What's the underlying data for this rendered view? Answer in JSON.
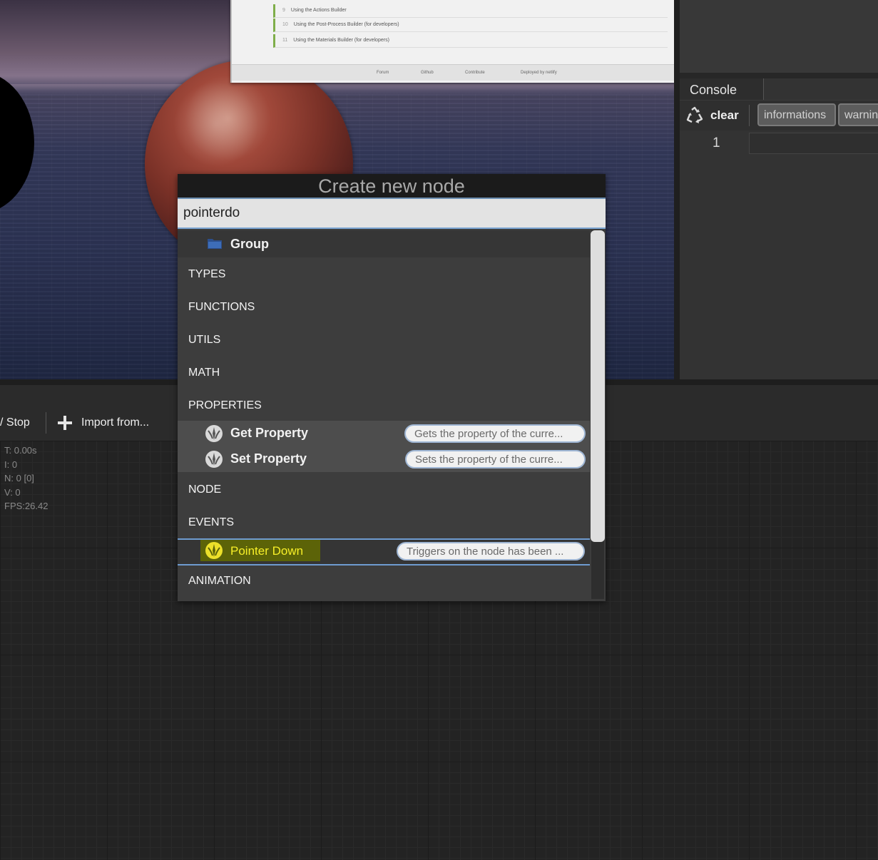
{
  "dialog": {
    "title": "Create new node",
    "search_value": "pointerdo",
    "group_label": "Group",
    "categories": {
      "types": "TYPES",
      "functions": "FUNCTIONS",
      "utils": "UTILS",
      "math": "MATH",
      "properties": "PROPERTIES",
      "node": "NODE",
      "events": "EVENTS",
      "animation": "ANIMATION"
    },
    "properties_items": [
      {
        "label": "Get Property",
        "description": "Gets the property of the curre..."
      },
      {
        "label": "Set Property",
        "description": "Sets the property of the curre..."
      }
    ],
    "events_items": [
      {
        "label": "Pointer Down",
        "description": "Triggers on the node has been ..."
      }
    ]
  },
  "console": {
    "tab_label": "Console",
    "clear_label": "clear",
    "filters": [
      "informations",
      "warnin"
    ],
    "line_number": "1"
  },
  "graph_toolbar": {
    "play_stop_label": "/ Stop",
    "import_label": "Import from..."
  },
  "stats": {
    "time": "T: 0.00s",
    "iterations": "I: 0",
    "nodes": "N: 0 [0]",
    "vertices": "V: 0",
    "fps": "FPS:26.42"
  },
  "doc_panel": {
    "lines": [
      {
        "num": "9",
        "text": "Using the Actions Builder"
      },
      {
        "num": "10",
        "text": "Using the Post-Process Builder (for developers)"
      },
      {
        "num": "11",
        "text": "Using the Materials Builder (for developers)"
      }
    ],
    "footer": [
      "Forum",
      "Github",
      "Contribute",
      "Deployed by netlify"
    ]
  },
  "colors": {
    "accent_blue": "#6e9bd0",
    "highlight_text": "#f7ef28",
    "highlight_bg": "#5c6308"
  }
}
